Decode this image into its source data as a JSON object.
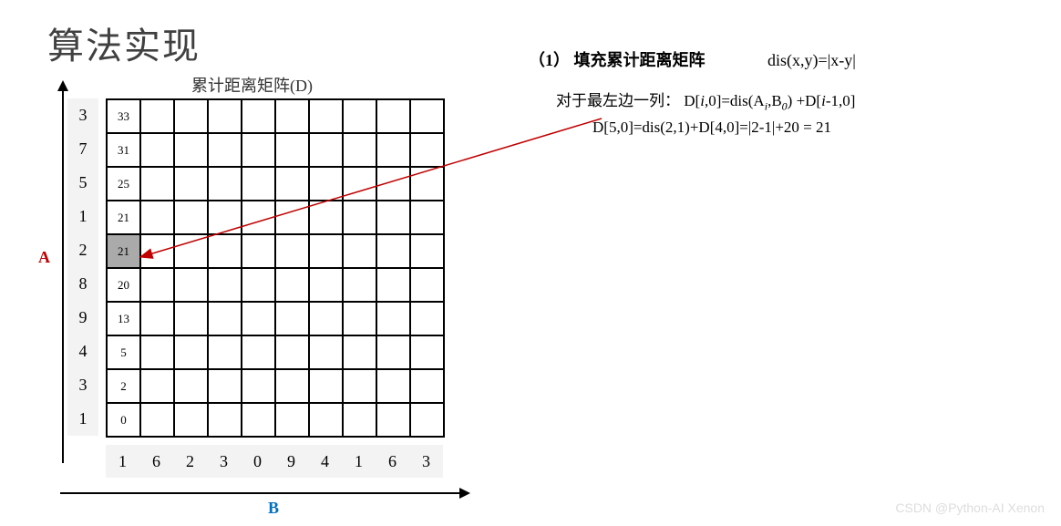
{
  "title": "算法实现",
  "subtitle": "累计距离矩阵(D)",
  "labelA": "A",
  "labelB": "B",
  "rowHeaders": [
    "3",
    "7",
    "5",
    "1",
    "2",
    "8",
    "9",
    "4",
    "3",
    "1"
  ],
  "colHeaders": [
    "1",
    "6",
    "2",
    "3",
    "0",
    "9",
    "4",
    "1",
    "6",
    "3"
  ],
  "firstColValues": [
    "33",
    "31",
    "25",
    "21",
    "21",
    "20",
    "13",
    "5",
    "2",
    "0"
  ],
  "highlightedRowIndex": 4,
  "rightText": {
    "step": "（1）",
    "stepTitle": "填充累计距离矩阵",
    "disFormula": "dis(x,y)=|x-y|",
    "line2_prefix": "对于最左边一列：",
    "line2_formula_parts": {
      "a": "D[",
      "i1": "i",
      "b": ",0]=dis(A",
      "sub1": "i",
      "c": ",B",
      "sub2": "0",
      "d": ") +D[",
      "i2": "i",
      "e": "-1,0]"
    },
    "line3": "D[5,0]=dis(2,1)+D[4,0]=|2-1|+20 = 21"
  },
  "watermark": "CSDN @Python-AI Xenon",
  "chart_data": {
    "type": "table",
    "title": "累计距离矩阵(D)",
    "description": "Dynamic programming cumulative distance matrix D for sequences A and B",
    "sequence_A": [
      1,
      3,
      4,
      9,
      8,
      2,
      1,
      5,
      7,
      3
    ],
    "sequence_B": [
      1,
      6,
      2,
      3,
      0,
      9,
      4,
      1,
      6,
      3
    ],
    "distance_fn": "dis(x,y)=|x-y|",
    "D_column0_bottom_to_top": [
      0,
      2,
      5,
      13,
      20,
      21,
      21,
      25,
      31,
      33
    ],
    "highlighted_cell": {
      "row_from_bottom": 5,
      "col": 0,
      "value": 21
    },
    "recurrence_left_col": "D[i,0]=dis(A_i,B_0)+D[i-1,0]",
    "example": "D[5,0]=dis(2,1)+D[4,0]=|2-1|+20=21"
  }
}
